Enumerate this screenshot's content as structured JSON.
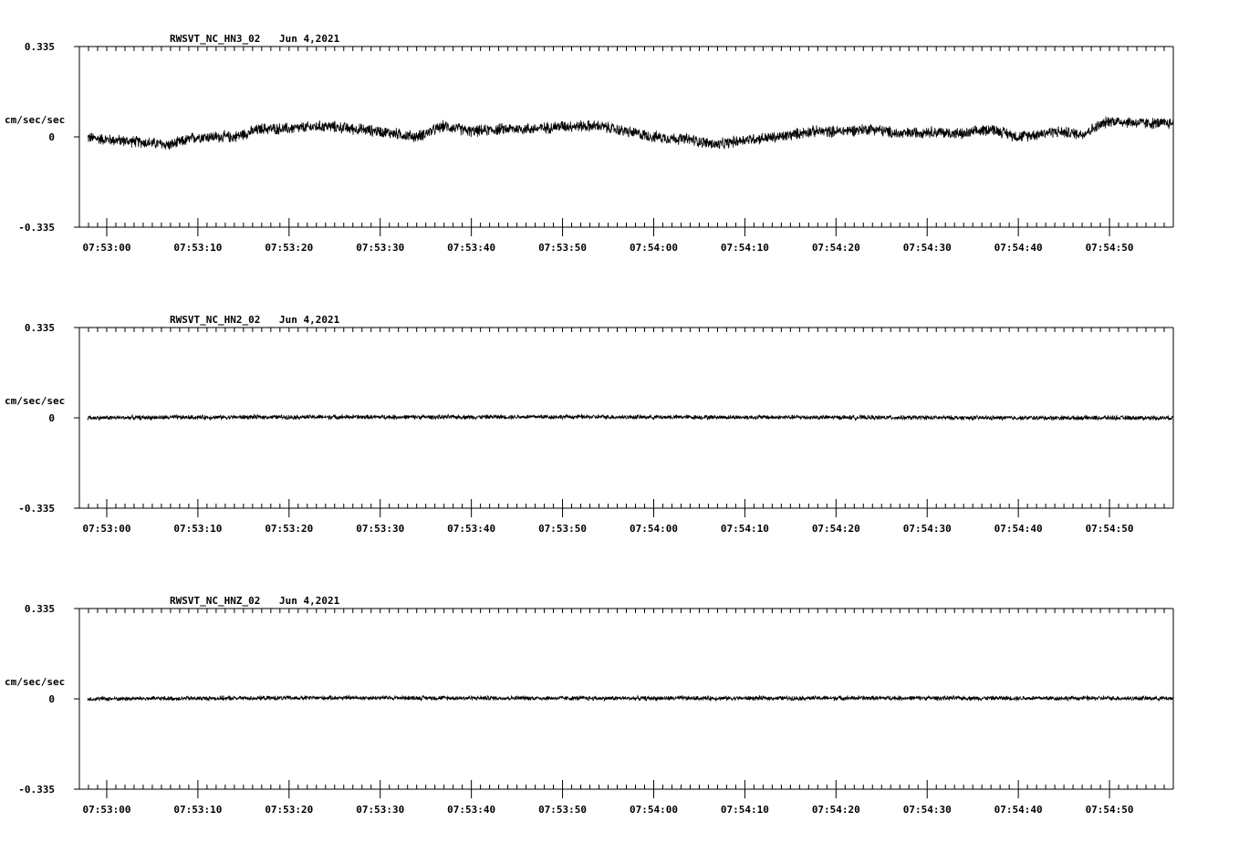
{
  "chart_data": [
    {
      "type": "line",
      "title": "RWSVT_NC_HN3_02",
      "date": "Jun 4,2021",
      "ylabel": "cm/sec/sec",
      "yticks": [
        "0.335",
        "0",
        "-0.335"
      ],
      "ylim": [
        -0.335,
        0.335
      ],
      "x_start": "07:52:57",
      "x_end": "07:54:57",
      "xticks": [
        "07:53:00",
        "07:53:10",
        "07:53:20",
        "07:53:30",
        "07:53:40",
        "07:53:50",
        "07:54:00",
        "07:54:10",
        "07:54:20",
        "07:54:30",
        "07:54:40",
        "07:54:50"
      ],
      "trend": {
        "x_seconds": [
          0,
          3,
          7,
          10,
          13,
          17,
          20,
          23,
          27,
          30,
          33,
          37,
          40,
          43,
          47,
          50,
          53,
          57,
          60,
          63,
          67,
          70,
          73,
          77,
          80,
          83,
          87,
          90,
          93,
          97,
          100,
          103,
          107,
          110,
          113,
          117,
          120
        ],
        "y": [
          0.0,
          -0.01,
          -0.02,
          -0.03,
          0.0,
          0.0,
          0.03,
          0.03,
          0.04,
          0.03,
          0.02,
          0.0,
          0.04,
          0.02,
          0.03,
          0.03,
          0.04,
          0.04,
          0.02,
          0.0,
          -0.01,
          -0.03,
          -0.01,
          0.0,
          0.02,
          0.02,
          0.03,
          0.01,
          0.02,
          0.01,
          0.03,
          0.0,
          0.02,
          0.01,
          0.06,
          0.05,
          0.05
        ]
      },
      "noise_amplitude": 0.018
    },
    {
      "type": "line",
      "title": "RWSVT_NC_HN2_02",
      "date": "Jun 4,2021",
      "ylabel": "cm/sec/sec",
      "yticks": [
        "0.335",
        "0",
        "-0.335"
      ],
      "ylim": [
        -0.335,
        0.335
      ],
      "x_start": "07:52:57",
      "x_end": "07:54:57",
      "xticks": [
        "07:53:00",
        "07:53:10",
        "07:53:20",
        "07:53:30",
        "07:53:40",
        "07:53:50",
        "07:54:00",
        "07:54:10",
        "07:54:20",
        "07:54:30",
        "07:54:40",
        "07:54:50"
      ],
      "trend": {
        "x_seconds": [
          0,
          20,
          40,
          50,
          60,
          80,
          100,
          120
        ],
        "y": [
          0.0,
          0.003,
          0.003,
          0.004,
          0.003,
          0.002,
          0.0,
          0.0
        ]
      },
      "noise_amplitude": 0.007
    },
    {
      "type": "line",
      "title": "RWSVT_NC_HNZ_02",
      "date": "Jun 4,2021",
      "ylabel": "cm/sec/sec",
      "yticks": [
        "0.335",
        "0",
        "-0.335"
      ],
      "ylim": [
        -0.335,
        0.335
      ],
      "x_start": "07:52:57",
      "x_end": "07:54:57",
      "xticks": [
        "07:53:00",
        "07:53:10",
        "07:53:20",
        "07:53:30",
        "07:53:40",
        "07:53:50",
        "07:54:00",
        "07:54:10",
        "07:54:20",
        "07:54:30",
        "07:54:40",
        "07:54:50"
      ],
      "trend": {
        "x_seconds": [
          0,
          30,
          60,
          90,
          120
        ],
        "y": [
          0.0,
          0.004,
          0.002,
          0.003,
          0.002
        ]
      },
      "noise_amplitude": 0.007
    }
  ]
}
